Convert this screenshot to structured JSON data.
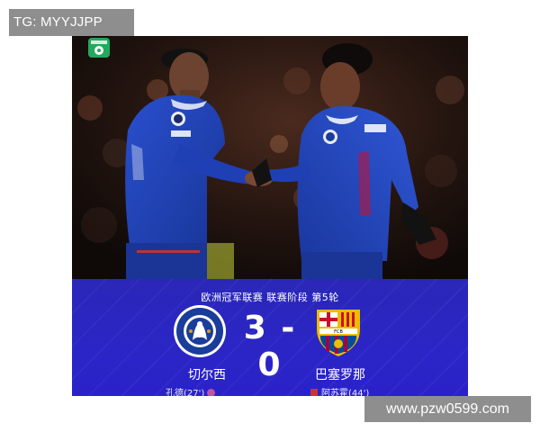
{
  "watermarks": {
    "top_left": "TG: MYYJJPP",
    "bottom_right": "www.pzw0599.com"
  },
  "match": {
    "stage": "欧洲冠军联赛  联赛阶段 第5轮",
    "score": "3 - 0",
    "home_team": "切尔西",
    "away_team": "巴塞罗那",
    "home_scorer": "孔德(27')",
    "away_scorer": "阿苏霍(44')"
  },
  "colors": {
    "panel_blue": "#2b25c6",
    "kit_blue": "#1f3fb4",
    "chelsea_blue": "#1a3c9a",
    "barca_red": "#c8102e",
    "barca_blue": "#004d98",
    "barca_gold": "#edbb00"
  },
  "icons": [
    "app-logo-icon",
    "chelsea-crest-icon",
    "barcelona-crest-icon",
    "ball-icon",
    "flag-icon"
  ]
}
